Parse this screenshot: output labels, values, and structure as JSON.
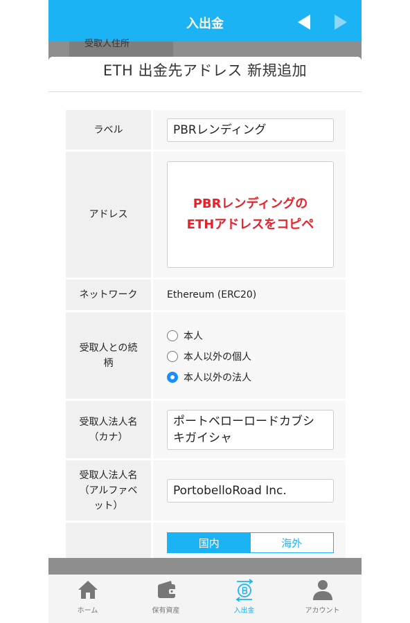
{
  "header": {
    "title": "入出金"
  },
  "background_row_label": "受取人住所",
  "modal": {
    "title": "ETH 出金先アドレス 新規追加"
  },
  "form": {
    "label": {
      "label": "ラベル",
      "value": "PBRレンディング"
    },
    "address": {
      "label": "アドレス",
      "annotation_line1": "PBRレンディングの",
      "annotation_line2": "ETHアドレスをコピペ"
    },
    "network": {
      "label": "ネットワーク",
      "value": "Ethereum (ERC20)"
    },
    "relationship": {
      "label_line1": "受取人との続",
      "label_line2": "柄",
      "options": [
        "本人",
        "本人以外の個人",
        "本人以外の法人"
      ],
      "selected": "本人以外の法人"
    },
    "corp_kana": {
      "label_line1": "受取人法人名",
      "label_line2": "（カナ）",
      "value_line1": "ポートベローロードカブシ",
      "value_line2": "キガイシャ"
    },
    "corp_alpha": {
      "label_line1": "受取人法人名",
      "label_line2": "（アルファベ",
      "label_line3": "ット）",
      "value": "PortobelloRoad Inc."
    },
    "location": {
      "options": [
        "国内",
        "海外"
      ],
      "selected": "国内"
    }
  },
  "tabbar": {
    "items": [
      {
        "label": "ホーム",
        "icon": "home-icon"
      },
      {
        "label": "保有資産",
        "icon": "wallet-icon"
      },
      {
        "label": "入出金",
        "icon": "bitcoin-transfer-icon"
      },
      {
        "label": "アカウント",
        "icon": "person-icon"
      }
    ],
    "active": "入出金"
  },
  "colors": {
    "accent": "#1cb3f5",
    "annotation": "#e8202a",
    "radio_selected": "#1a8cff"
  }
}
